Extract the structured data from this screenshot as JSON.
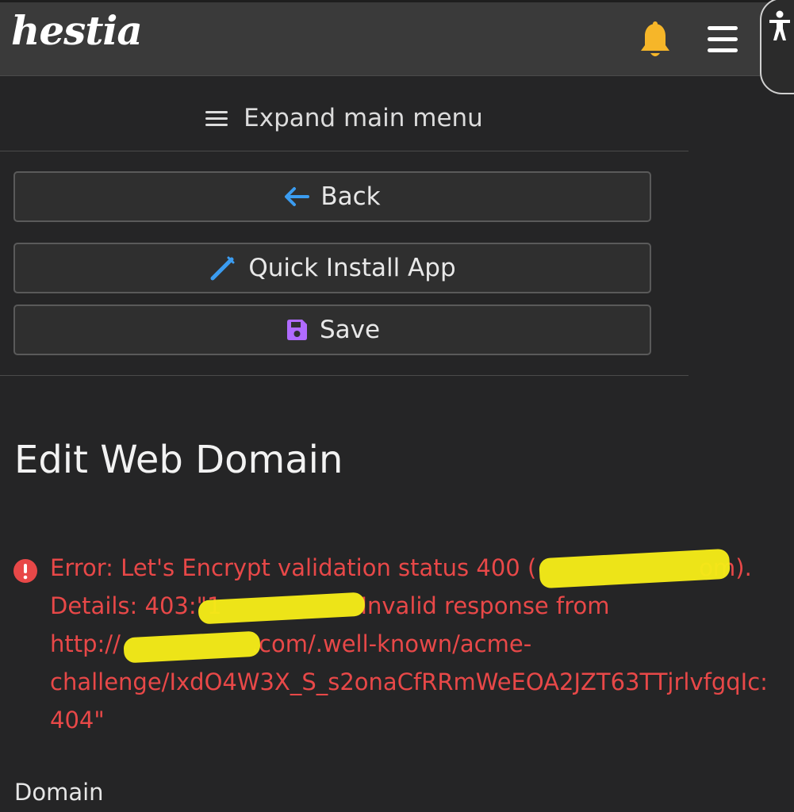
{
  "header": {
    "logo_text": "hestia",
    "icons": [
      "bell-icon",
      "hamburger-menu-icon",
      "accessibility-icon"
    ],
    "bell_color": "#f6b629"
  },
  "menu": {
    "expand_label": "Expand main menu"
  },
  "toolbar": {
    "back_label": "Back",
    "quick_install_label": "Quick Install App",
    "save_label": "Save",
    "back_icon_color": "#3b9cf0",
    "quick_icon_color": "#3b9cf0",
    "save_icon_color": "#b06bff"
  },
  "page": {
    "title": "Edit Web Domain"
  },
  "error": {
    "color": "#e84848",
    "lines": [
      "Error: Let's Encrypt validation status 400 (",
      "om).",
      "Details: 403:\"1",
      "Invalid response from",
      "http://",
      ".com/.well-known/acme-",
      "challenge/IxdO4W3X_S_s2onaCfRRmWeEOA2JZT63TTjrlvfgqIc:",
      "404\""
    ]
  },
  "form": {
    "domain_label": "Domain"
  }
}
